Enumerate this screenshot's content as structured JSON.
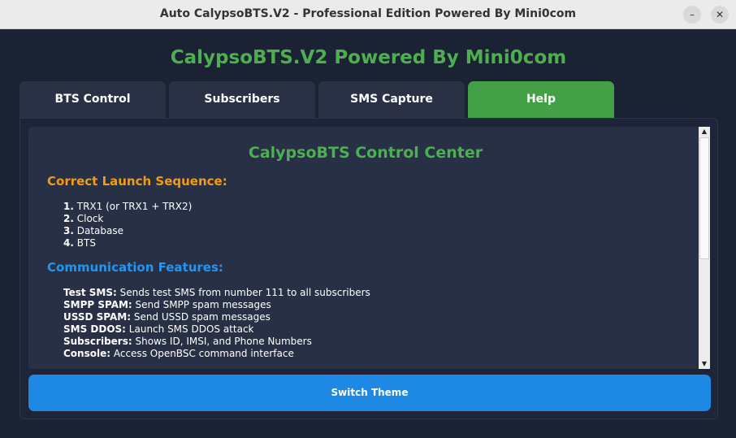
{
  "window": {
    "title": "Auto CalypsoBTS.V2 - Professional Edition Powered By Mini0com",
    "minimize_glyph": "–",
    "close_glyph": "✕"
  },
  "app": {
    "title": "CalypsoBTS.V2 Powered By Mini0com"
  },
  "tabs": [
    {
      "label": "BTS Control",
      "active": false
    },
    {
      "label": "Subscribers",
      "active": false
    },
    {
      "label": "SMS Capture",
      "active": false
    },
    {
      "label": "Help",
      "active": true
    }
  ],
  "help": {
    "heading": "CalypsoBTS Control Center",
    "launch": {
      "title": "Correct Launch Sequence:",
      "steps": [
        {
          "num": "1.",
          "text": "TRX1 (or TRX1 + TRX2)"
        },
        {
          "num": "2.",
          "text": "Clock"
        },
        {
          "num": "3.",
          "text": "Database"
        },
        {
          "num": "4.",
          "text": "BTS"
        }
      ]
    },
    "features": {
      "title": "Communication Features:",
      "items": [
        {
          "name": "Test SMS:",
          "desc": "Sends test SMS from number 111 to all subscribers"
        },
        {
          "name": "SMPP SPAM:",
          "desc": "Send SMPP spam messages"
        },
        {
          "name": "USSD SPAM:",
          "desc": "Send USSD spam messages"
        },
        {
          "name": "SMS DDOS:",
          "desc": "Launch SMS DDOS attack"
        },
        {
          "name": "Subscribers:",
          "desc": "Shows ID, IMSI, and Phone Numbers"
        },
        {
          "name": "Console:",
          "desc": "Access OpenBSC command interface"
        }
      ]
    }
  },
  "scroll": {
    "up_glyph": "▲",
    "down_glyph": "▼"
  },
  "switch_theme_label": "Switch Theme",
  "colors": {
    "accent_green": "#4caf50",
    "section_orange": "#f39c12",
    "section_blue": "#2196f3",
    "button_blue": "#1e88e5"
  }
}
